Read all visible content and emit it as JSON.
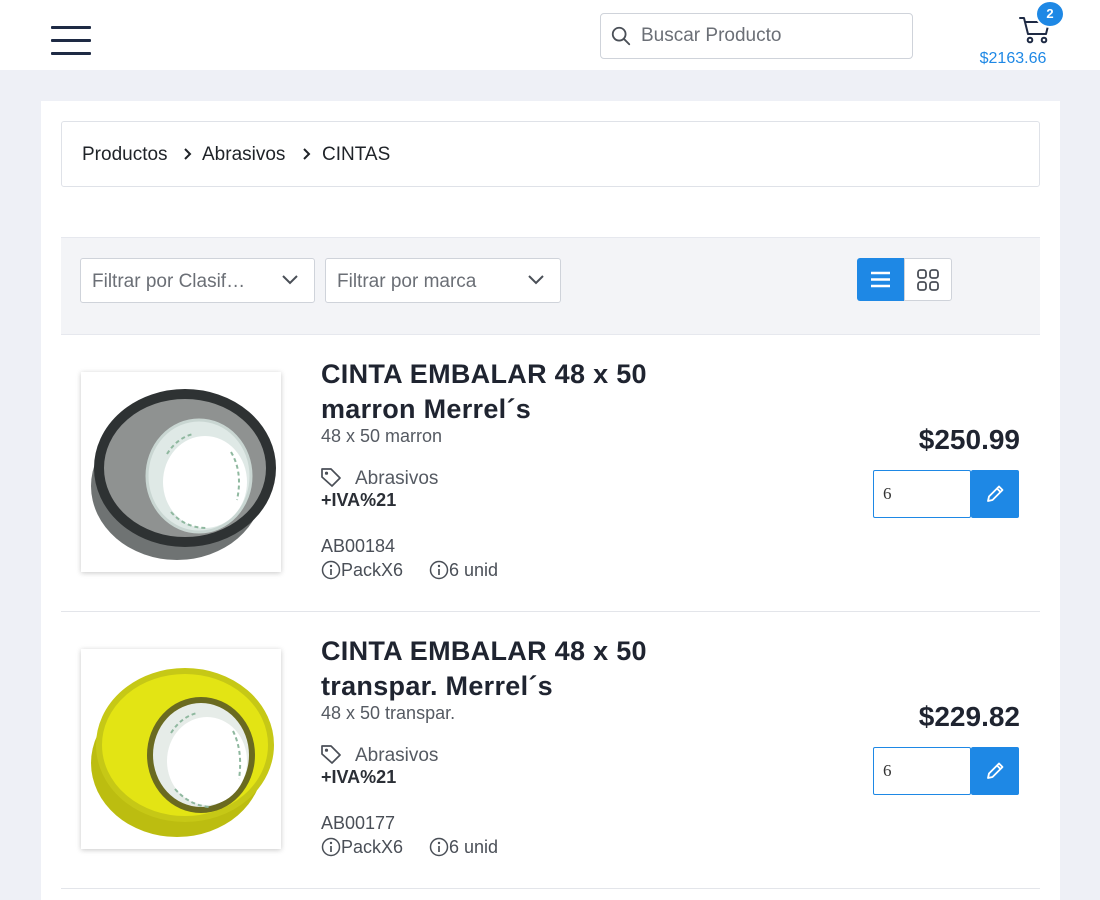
{
  "header": {
    "menu_icon": "hamburger-menu-icon",
    "search": {
      "placeholder": "Buscar Producto",
      "icon": "search-icon"
    },
    "cart": {
      "icon": "shopping-cart-icon",
      "count": "2",
      "total": "$2163.66"
    }
  },
  "breadcrumb": [
    {
      "label": "Productos"
    },
    {
      "label": "Abrasivos"
    },
    {
      "label": "CINTAS"
    }
  ],
  "filters": {
    "classification": "Filtrar por Clasif…",
    "brand": "Filtrar por marca",
    "view_list_icon": "list-view-icon",
    "view_grid_icon": "grid-view-icon",
    "active_view": "list"
  },
  "products": [
    {
      "title": "CINTA EMBALAR 48 x 50 marron Merrel´s",
      "description": "48 x 50 marron",
      "category": "Abrasivos",
      "tax": "+IVA%21",
      "sku": "AB00184",
      "pack": "PackX6",
      "units": "6 unid",
      "price": "$250.99",
      "quantity": "6",
      "tape_color": "#8f9291"
    },
    {
      "title": "CINTA EMBALAR 48 x 50 transpar. Merrel´s",
      "description": "48 x 50 transpar.",
      "category": "Abrasivos",
      "tax": "+IVA%21",
      "sku": "AB00177",
      "pack": "PackX6",
      "units": "6 unid",
      "price": "$229.82",
      "quantity": "6",
      "tape_color": "#e3e414"
    }
  ],
  "colors": {
    "accent": "#1e88e5",
    "page_background": "#eef0f6"
  }
}
